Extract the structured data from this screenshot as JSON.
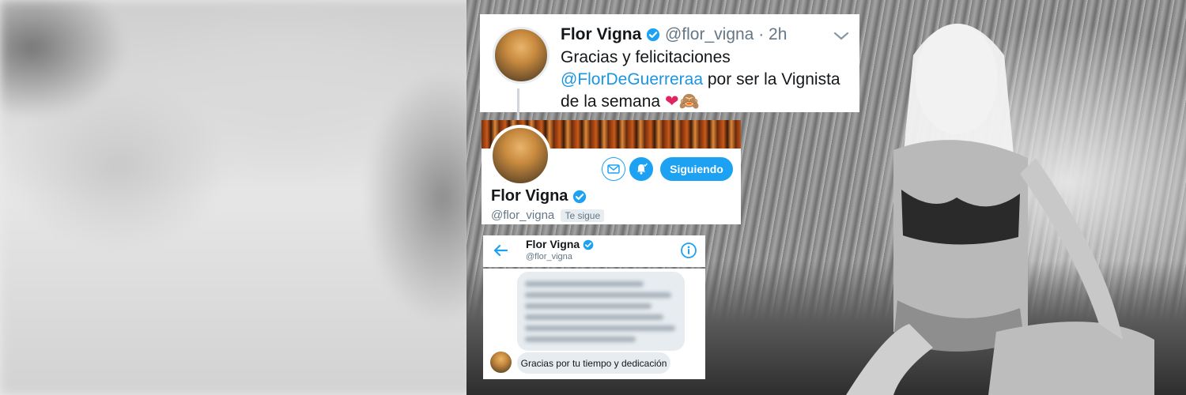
{
  "tweet": {
    "name": "Flor Vigna",
    "meta": "@flor_vigna · 2h",
    "text_line1": "Gracias y felicitaciones",
    "mention": "@FlorDeGuerreraa",
    "text_rest": " por ser la Vignista de la semana",
    "emoji": "❤🙈"
  },
  "profile": {
    "name": "Flor Vigna",
    "handle": "@flor_vigna",
    "follows_badge": "Te sigue",
    "follow_button": "Siguiendo"
  },
  "dm": {
    "name": "Flor Vigna",
    "handle": "@flor_vigna",
    "reply": "Gracias por tu tiempo y dedicación"
  },
  "colors": {
    "twitter_blue": "#1da1f2",
    "mention_blue": "#1b95e0",
    "verified_blue": "#1da1f2"
  },
  "icons": [
    "verified-icon",
    "chevron-down-icon",
    "mail-icon",
    "bell-icon",
    "back-arrow-icon",
    "info-icon"
  ]
}
